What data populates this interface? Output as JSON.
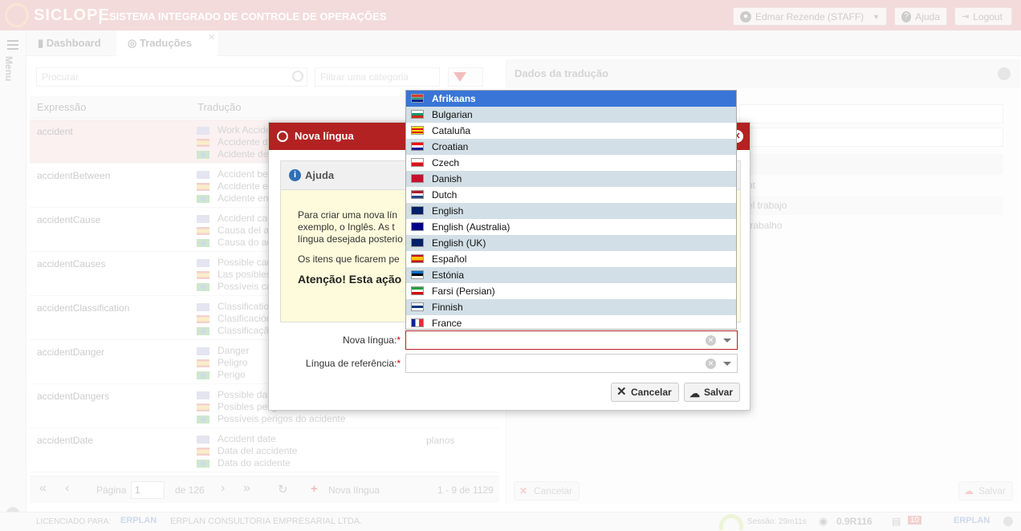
{
  "header": {
    "logo_text": "SICLOPE",
    "system_title": "SISTEMA INTEGRADO DE CONTROLE DE OPERAÇÕES",
    "user_label": "Edmar Rezende (STAFF)",
    "help_label": "Ajuda",
    "logout_label": "Logout"
  },
  "rail": {
    "menu_label": "Menu"
  },
  "tabs": [
    {
      "label": "Dashboard"
    },
    {
      "label": "Traduções"
    }
  ],
  "list": {
    "search_placeholder": "Procurar",
    "filter_placeholder": "Filtrar uma categoria",
    "col_expression": "Expressão",
    "col_translation": "Tradução",
    "rows": [
      {
        "expr": "accident",
        "t": [
          "Work Accident",
          "Accidente de trabajo",
          "Acidente de trabalho"
        ]
      },
      {
        "expr": "accidentBetween",
        "t": [
          "Accident between",
          "Accidente entre",
          "Acidente entre"
        ]
      },
      {
        "expr": "accidentCause",
        "t": [
          "Accident cause",
          "Causa del accidente",
          "Causa do acidente"
        ]
      },
      {
        "expr": "accidentCauses",
        "t": [
          "Possible causes",
          "Las posibles causas",
          "Possíveis causas"
        ]
      },
      {
        "expr": "accidentClassification",
        "t": [
          "Classification",
          "Clasificación",
          "Classificação"
        ]
      },
      {
        "expr": "accidentDanger",
        "t": [
          "Danger",
          "Peligro",
          "Perigo"
        ]
      },
      {
        "expr": "accidentDangers",
        "t": [
          "Possible dangers",
          "Posibles peligros",
          "Possíveis perigos do acidente"
        ]
      },
      {
        "expr": "accidentDate",
        "t": [
          "Accident date",
          "Data del accidente",
          "Data do acidente"
        ],
        "extra": "planos"
      }
    ],
    "pager": {
      "page_label": "Página",
      "page_value": "1",
      "of_label": "de 126",
      "new_lang": "Nova língua",
      "range": "1 - 9 de 1129"
    }
  },
  "detail": {
    "title": "Dados da tradução",
    "values": [
      "nt",
      "el trabajo",
      "trabalho"
    ],
    "cancel_label": "Cancelar",
    "save_label": "Salvar"
  },
  "status": {
    "licensed_label": "LICENCIADO PARA:",
    "brand": "ERPLAN",
    "company": "ERPLAN CONSULTORIA EMPRESARIAL LTDA.",
    "session": "Sessão: 29m11s",
    "version": "0.9R116",
    "count": "10",
    "brand2": "ERPLAN"
  },
  "modal": {
    "title": "Nova língua",
    "help_title": "Ajuda",
    "help_p1_line1": "Para criar uma nova lín",
    "help_p1_line2": "exemplo, o Inglês. As t",
    "help_p1_line3": "língua desejada posterio",
    "help_p2": "Os itens que ficarem pe",
    "help_warn": "Atenção! Esta ação",
    "new_lang_label": "Nova língua:",
    "ref_lang_label": "Língua de referência:",
    "required_mark": "*",
    "cancel_label": "Cancelar",
    "save_label": "Salvar"
  },
  "dropdown": {
    "options": [
      {
        "label": "Afrikaans",
        "flag": "za"
      },
      {
        "label": "Bulgarian",
        "flag": "bg"
      },
      {
        "label": "Cataluña",
        "flag": "ct"
      },
      {
        "label": "Croatian",
        "flag": "hr"
      },
      {
        "label": "Czech",
        "flag": "cz"
      },
      {
        "label": "Danish",
        "flag": "dk"
      },
      {
        "label": "Dutch",
        "flag": "nl"
      },
      {
        "label": "English",
        "flag": "gb"
      },
      {
        "label": "English (Australia)",
        "flag": "au"
      },
      {
        "label": "English (UK)",
        "flag": "gb"
      },
      {
        "label": "Español",
        "flag": "es"
      },
      {
        "label": "Estónia",
        "flag": "ee"
      },
      {
        "label": "Farsi (Persian)",
        "flag": "ir"
      },
      {
        "label": "Finnish",
        "flag": "fi"
      },
      {
        "label": "France",
        "flag": "fr"
      }
    ],
    "highlighted": "Afrikaans"
  }
}
